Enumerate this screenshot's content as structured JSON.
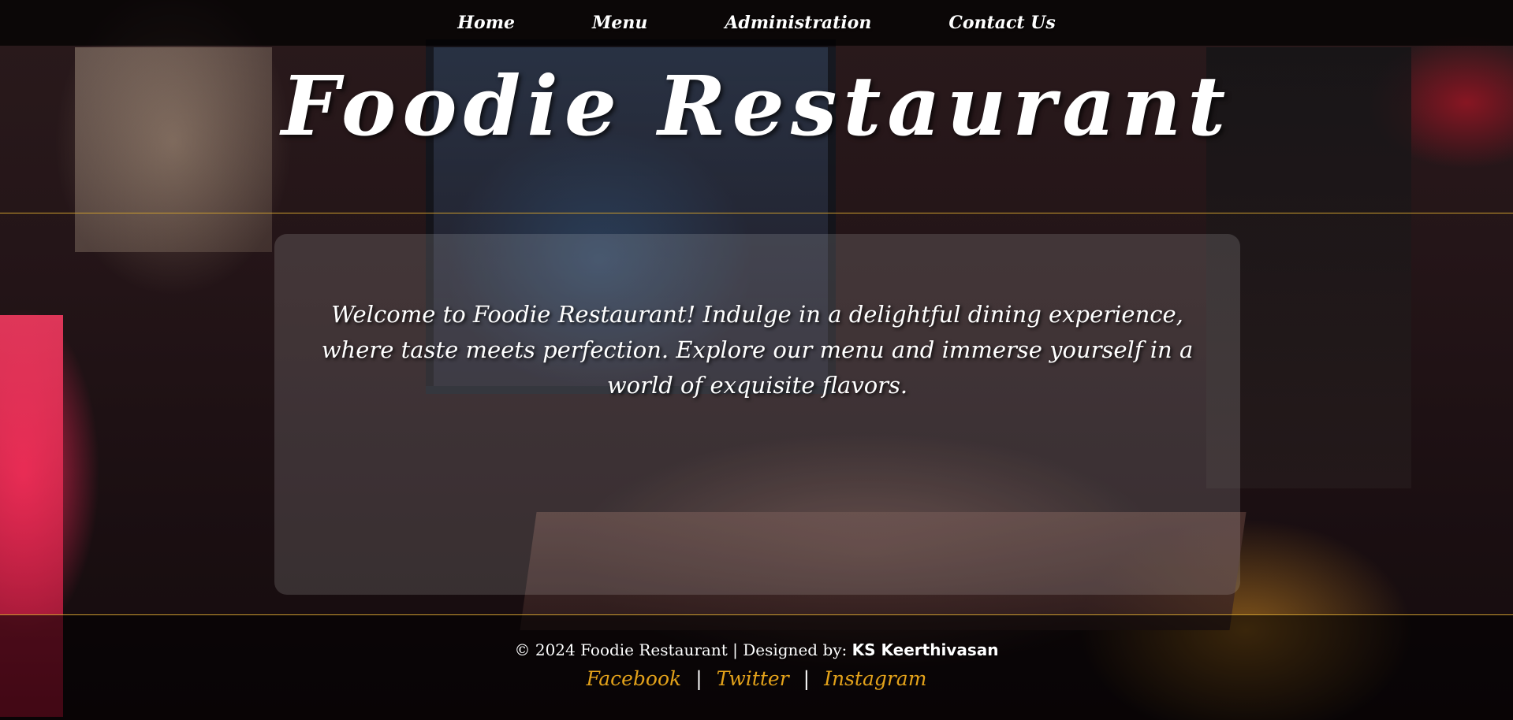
{
  "nav": {
    "items": [
      {
        "label": "Home"
      },
      {
        "label": "Menu"
      },
      {
        "label": "Administration"
      },
      {
        "label": "Contact Us"
      }
    ]
  },
  "hero": {
    "title": "Foodie Restaurant",
    "welcome": "Welcome to Foodie Restaurant! Indulge in a delightful dining experience, where taste meets perfection. Explore our menu and immerse yourself in a world of exquisite flavors."
  },
  "footer": {
    "credit_prefix": "© 2024 Foodie Restaurant | Designed by: ",
    "author": "KS Keerthivasan",
    "social": [
      {
        "label": "Facebook"
      },
      {
        "label": "Twitter"
      },
      {
        "label": "Instagram"
      }
    ],
    "separator": "|"
  },
  "colors": {
    "accent": "#e3a21a",
    "rule": "#c99a2e"
  },
  "background": {
    "icon": "restaurant-interior-photo"
  }
}
